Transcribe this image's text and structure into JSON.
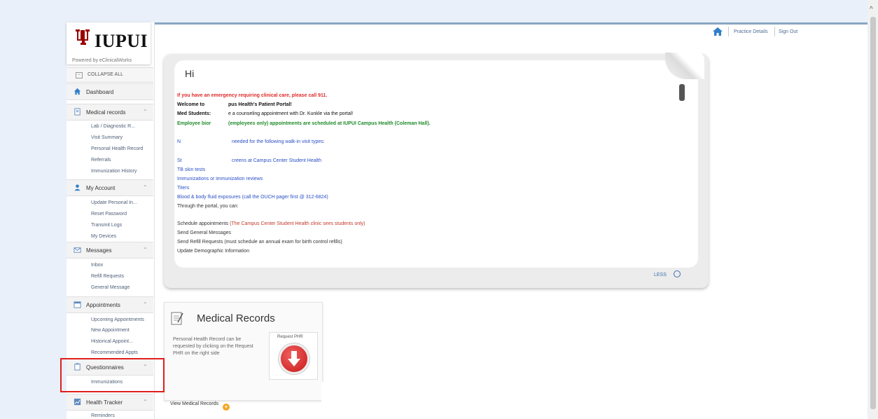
{
  "logo": {
    "text": "IUPUI",
    "powered_by": "Powered by eClinicalWorks"
  },
  "sidebar": {
    "collapse_label": "COLLAPSE ALL",
    "dashboard": "Dashboard",
    "sections": [
      {
        "label": "Medical records",
        "icon": "file-icon",
        "items": [
          "Lab / Diagnostic R...",
          "Visit Summary",
          "Personal Health Record",
          "Referrals",
          "Immunization History"
        ]
      },
      {
        "label": "My Account",
        "icon": "user-icon",
        "items": [
          "Update Personal In...",
          "Reset Password",
          "Transmit Logs",
          "My Devices"
        ]
      },
      {
        "label": "Messages",
        "icon": "envelope-icon",
        "items": [
          "Inbox",
          "Refill Requests",
          "General Message"
        ]
      },
      {
        "label": "Appointments",
        "icon": "calendar-icon",
        "items": [
          "Upcoming Appointments",
          "New Appointment",
          "Historical Appoint...",
          "Recommended Appts"
        ]
      },
      {
        "label": "Questionnaires",
        "icon": "clipboard-icon",
        "items": [
          "Immunizations"
        ]
      },
      {
        "label": "Health Tracker",
        "icon": "chart-icon",
        "items": [
          "Reminders"
        ]
      }
    ]
  },
  "util": {
    "practice_details": "Practice Details",
    "sign_out": "Sign Out"
  },
  "welcome": {
    "greeting": "Hi",
    "emergency": "If you have an emergency requiring clinical care, please call 911.",
    "welcome_a": "Welcome to",
    "welcome_b": "pus Health's Patient Portal!",
    "med_a": "Med Students:",
    "med_b": "e a counseling appointment with Dr. Kunkle via the portal!",
    "emp_a": "Employee bior",
    "emp_b": "(employees only) appointments are scheduled at IUPUI Campus Health (Coleman Hall).",
    "needed_a": "N",
    "needed_b": "needed for the following walk-in visit types:",
    "screens_a": "St",
    "screens_b": "creens at Campus Center Student Health",
    "tb": "TB skin tests",
    "immun": "Immunizations or immunization reviews",
    "titers": "Titers",
    "blood": "Blood & body fluid exposures (call the OUCH pager first @ 312-6824)",
    "through": "Through the portal, you can:",
    "schedule": "Schedule appointments",
    "schedule_note": "(The Campus Center Student Health clinic sees students only)",
    "send_general": "Send General Messages",
    "send_refill": "Send Refill Requests (must schedule an annual exam for birth control refills)",
    "update_demo": "Update Demographic Information",
    "less": "LESS"
  },
  "medical_records": {
    "title": "Medical Records",
    "description": "Personal Health Record can be requested by clicking on the Request PHR on the right side",
    "request_label": "Request PHR",
    "view_label": "View Medical Records"
  },
  "colors": {
    "highlight": "#e0201c",
    "emergency": "#e02a2a",
    "employee": "#1f8b2a",
    "link": "#2a4fc4",
    "brand": "#990000"
  }
}
